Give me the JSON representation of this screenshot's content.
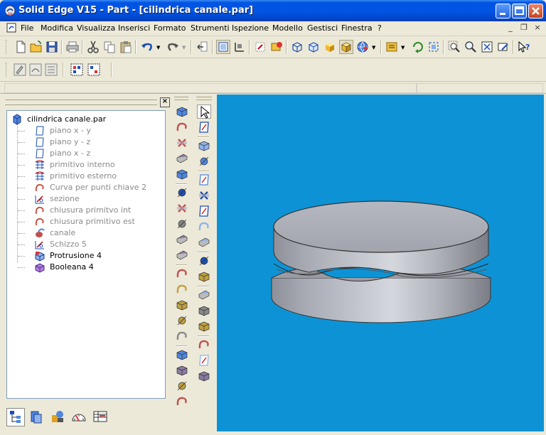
{
  "window": {
    "title": "Solid Edge V15 - Part - [cilindrica canale.par]",
    "icon": "solid-edge-app-icon",
    "controls": [
      "minimize",
      "maximize",
      "close"
    ]
  },
  "menubar": {
    "items": [
      "File",
      "Modifica",
      "Visualizza",
      "Inserisci",
      "Formato",
      "Strumenti",
      "Ispezione",
      "Modello",
      "Gestisci",
      "Finestra",
      "?"
    ],
    "mdi_controls": [
      "_",
      "❐",
      "×"
    ]
  },
  "pathfinder": {
    "tree": [
      {
        "label": "cilindrica canale.par",
        "icon": "part-icon",
        "dim": false
      },
      {
        "label": "piano x - y",
        "icon": "plane-icon",
        "dim": true
      },
      {
        "label": "piano y - z",
        "icon": "plane-icon",
        "dim": true
      },
      {
        "label": "piano x - z",
        "icon": "plane-icon",
        "dim": true
      },
      {
        "label": "primitivo interno",
        "icon": "surface-icon",
        "dim": true
      },
      {
        "label": "primitivo esterno",
        "icon": "surface-icon",
        "dim": true
      },
      {
        "label": "Curva per punti chiave 2",
        "icon": "curve-icon",
        "dim": true
      },
      {
        "label": "sezione",
        "icon": "sketch-icon",
        "dim": true
      },
      {
        "label": "chiusura primitvo int",
        "icon": "curve-icon",
        "dim": true
      },
      {
        "label": "chiusura primitivo est",
        "icon": "curve-icon",
        "dim": true
      },
      {
        "label": "canale",
        "icon": "sweep-icon",
        "dim": true
      },
      {
        "label": "Schizzo 5",
        "icon": "sketch-icon",
        "dim": true
      },
      {
        "label": "Protrusione 4",
        "icon": "protrusion-icon",
        "dim": false
      },
      {
        "label": "Booleana 4",
        "icon": "boolean-icon",
        "dim": false
      }
    ],
    "tabs": [
      "feature-pathfinder-tab",
      "layers-tab",
      "sensors-tab",
      "dashboard-tab",
      "family-tab"
    ]
  },
  "colors": {
    "viewport_bg": "#0d93d5",
    "part_shade": "#a7a9b4",
    "titlebar": "#0055e5"
  }
}
